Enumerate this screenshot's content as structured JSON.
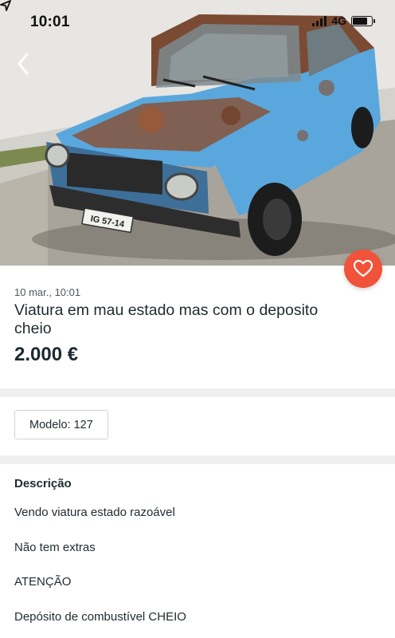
{
  "status_bar": {
    "time": "10:01",
    "network": "4G"
  },
  "listing": {
    "date": "10 mar., 10:01",
    "title": "Viatura em mau estado mas com o deposito cheio",
    "price": "2.000 €",
    "plate": "IG 57-14"
  },
  "attributes": {
    "model": "Modelo: 127"
  },
  "description": {
    "heading": "Descrição",
    "lines": [
      "Vendo viatura estado razoável",
      "Não tem extras",
      "ATENÇÃO",
      "Depósito de combustível CHEIO"
    ]
  },
  "colors": {
    "favorite_button": "#f0533a",
    "car_body": "#5aa7dd",
    "rust": "#8a4b2a"
  },
  "icons": {
    "back": "chevron-left-icon",
    "favorite": "heart-icon",
    "location": "location-arrow-icon"
  }
}
